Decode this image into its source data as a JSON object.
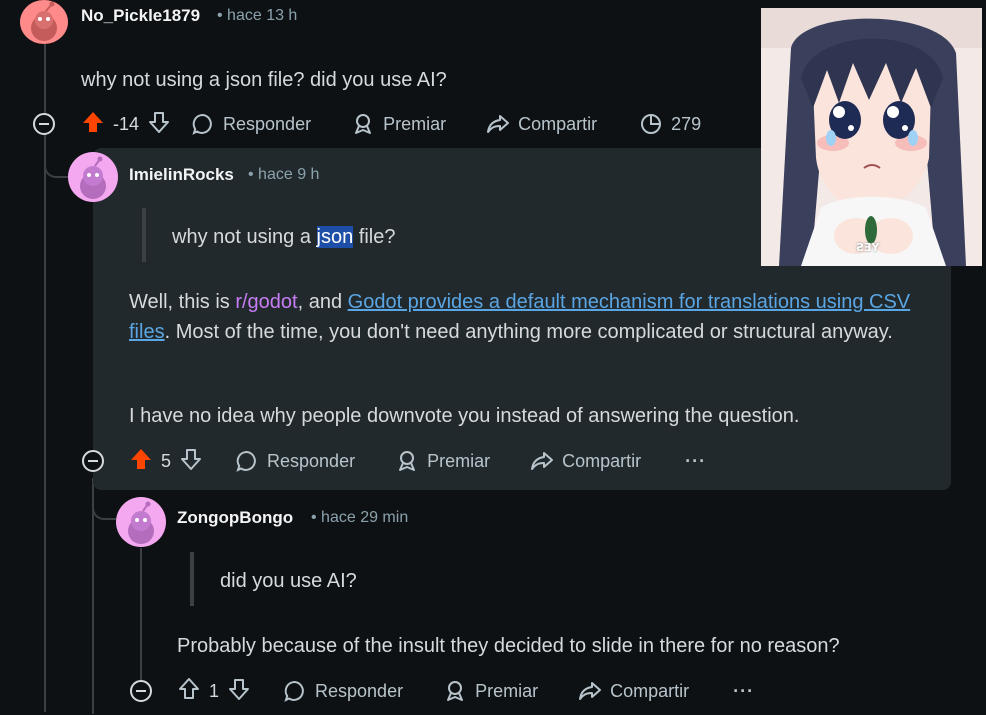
{
  "comment1": {
    "username": "No_Pickle1879",
    "time": "hace 13 h",
    "text": "why not using a json file? did you use AI?",
    "score": "-14",
    "reply_label": "Responder",
    "award_label": "Premiar",
    "share_label": "Compartir",
    "views": "279"
  },
  "comment2": {
    "username": "ImielinRocks",
    "time": "hace 9 h",
    "quote_before": "why not using a ",
    "quote_highlight": "json",
    "quote_after": " file?",
    "p1_a": "Well, this is ",
    "p1_sub": "r/godot",
    "p1_b": ", and ",
    "p1_link": "Godot provides a default mechanism for translations using CSV files",
    "p1_c": ". Most of the time, you don't need anything more complicated or structural anyway.",
    "p2": "I have no idea why people downvote you instead of answering the question.",
    "score": "5",
    "reply_label": "Responder",
    "award_label": "Premiar",
    "share_label": "Compartir",
    "more_label": "···"
  },
  "comment3": {
    "username": "ZongopBongo",
    "time": "hace 29 min",
    "quote": "did you use AI?",
    "text": "Probably because of the insult they decided to slide in there for no reason?",
    "score": "1",
    "reply_label": "Responder",
    "award_label": "Premiar",
    "share_label": "Compartir",
    "more_label": "···"
  },
  "overlay": {
    "caption": "YES"
  },
  "colors": {
    "background": "#0e1113",
    "card": "#22292c",
    "upvote_active": "#ff4500",
    "link": "#5aa6e4",
    "subreddit": "#c77df5"
  }
}
